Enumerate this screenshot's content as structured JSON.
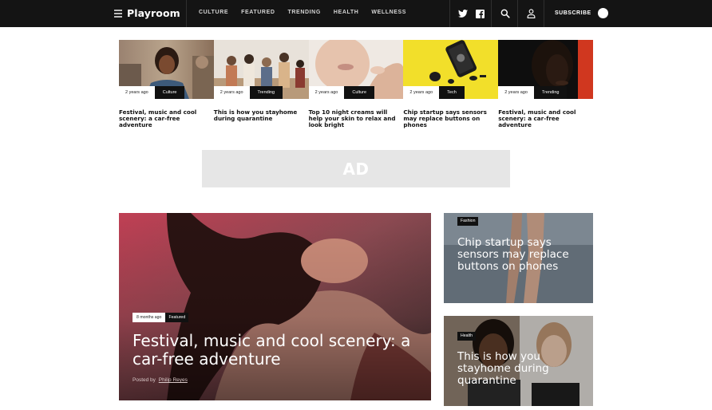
{
  "header": {
    "logo": "Playroom",
    "nav": [
      "CULTURE",
      "FEATURED",
      "TRENDING",
      "HEALTH",
      "WELLNESS"
    ],
    "icons": [
      "twitter-icon",
      "facebook-icon",
      "search-icon",
      "user-icon"
    ],
    "subscribe": "SUBSCRIBE"
  },
  "cards": [
    {
      "date": "2 years ago",
      "category": "Culture",
      "title": "Festival, music and cool scenery: a car-free adventure"
    },
    {
      "date": "2 years ago",
      "category": "Trending",
      "title": "This is how you stayhome during quarantine"
    },
    {
      "date": "2 years ago",
      "category": "Culture",
      "title": "Top 10 night creams will help your skin to relax and look bright"
    },
    {
      "date": "2 years ago",
      "category": "Tech",
      "title": "Chip startup says sensors may replace buttons on phones"
    },
    {
      "date": "2 years ago",
      "category": "Trending",
      "title": "Festival, music and cool scenery: a car-free adventure"
    }
  ],
  "ad": {
    "label": "AD"
  },
  "feature": {
    "date": "8 months ago",
    "category": "Featured",
    "title": "Festival, music and cool scenery: a car-free adventure",
    "byline_prefix": "Posted by",
    "author": "Philip Reyes"
  },
  "side": [
    {
      "category": "Fashion",
      "title": "Chip startup says sensors may replace buttons on phones"
    },
    {
      "category": "Health",
      "title": "This is how you stayhome during quarantine"
    }
  ],
  "colors": {
    "topbar": "#141414",
    "accent_dark": "#111111",
    "ad_bg": "#e6e6e6"
  }
}
